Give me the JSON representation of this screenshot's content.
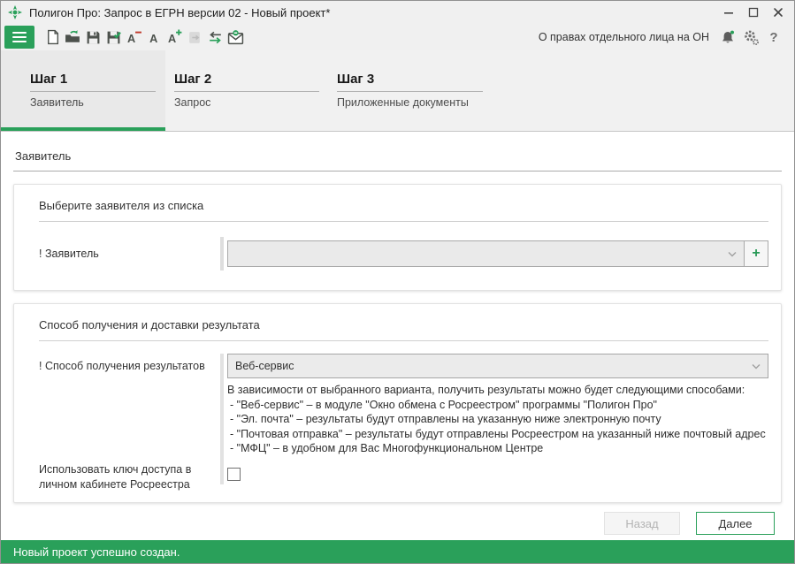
{
  "colors": {
    "accent_green": "#2aa05a",
    "status_bar_bg": "#2aa05a",
    "minus_red": "#c0392b",
    "disabled_text": "#b4b4b4"
  },
  "titlebar": {
    "title": "Полигон Про: Запрос в ЕГРН версии 02 - Новый проект*"
  },
  "toolbar": {
    "doc_type_label": "О правах отдельного лица на ОН",
    "help_label": "?"
  },
  "steps": [
    {
      "num": "Шаг 1",
      "label": "Заявитель",
      "active": true
    },
    {
      "num": "Шаг 2",
      "label": "Запрос",
      "active": false
    },
    {
      "num": "Шаг 3",
      "label": "Приложенные документы",
      "active": false
    }
  ],
  "content": {
    "section_title": "Заявитель",
    "applicant_panel": {
      "title": "Выберите заявителя из списка",
      "field_label": "! Заявитель",
      "field_value": "",
      "add_button": "+"
    },
    "delivery_panel": {
      "title": "Способ получения и доставки результата",
      "method_label": "! Способ получения результатов",
      "method_value": "Веб-сервис",
      "info_intro": "В зависимости от выбранного варианта, получить результаты можно будет следующими способами:",
      "info_items": [
        "- \"Веб-сервис\" – в модуле \"Окно обмена с Росреестром\" программы \"Полигон Про\"",
        "- \"Эл. почта\" – результаты будут отправлены на указанную ниже электронную почту",
        "- \"Почтовая отправка\" – результаты будут отправлены Росреестром на указанный ниже почтовый адрес",
        "- \"МФЦ\" – в удобном для Вас Многофункциональном Центре"
      ],
      "access_key_label": "Использовать ключ доступа в личном кабинете Росреестра",
      "access_key_checked": false
    }
  },
  "footer": {
    "back_label": "Назад",
    "next_label": "Далее"
  },
  "statusbar": {
    "message": "Новый проект успешно создан."
  }
}
